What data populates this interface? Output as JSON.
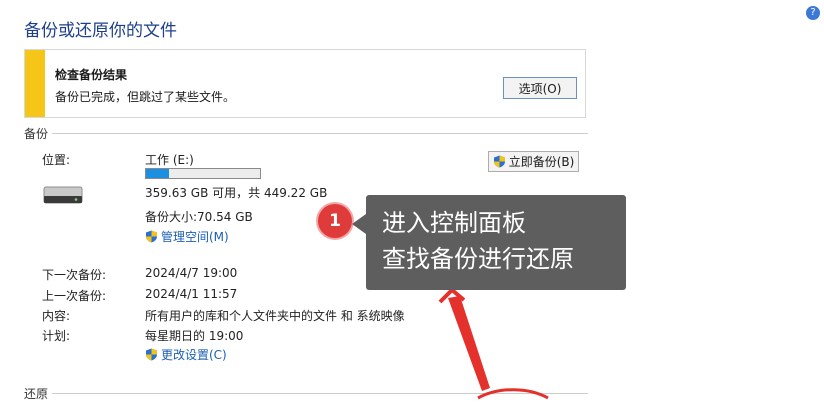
{
  "page": {
    "title": "备份或还原你的文件"
  },
  "warning": {
    "title": "检查备份结果",
    "message": "备份已完成，但跳过了某些文件。",
    "options_button": "选项(O)",
    "accent_color": "#f5c518"
  },
  "backup": {
    "section_label": "备份",
    "location_label": "位置:",
    "drive_name": "工作 (E:)",
    "drive_used_fraction": 0.2,
    "free_space_text": "359.63 GB 可用，共 449.22 GB",
    "backup_size_text": "备份大小:70.54 GB",
    "manage_space_link": "管理空间(M)",
    "backup_now_button": "立即备份(B)",
    "next_backup_label": "下一次备份:",
    "next_backup_value": "2024/4/7 19:00",
    "last_backup_label": "上一次备份:",
    "last_backup_value": "2024/4/1 11:57",
    "contents_label": "内容:",
    "contents_value": "所有用户的库和个人文件夹中的文件 和 系统映像",
    "schedule_label": "计划:",
    "schedule_value": "每星期日的 19:00",
    "change_settings_link": "更改设置(C)"
  },
  "restore": {
    "section_label": "还原"
  },
  "callout": {
    "step": "1",
    "line1": "进入控制面板",
    "line2": "查找备份进行还原",
    "badge_color": "#e03b3b"
  },
  "icons": [
    "question-icon",
    "drive-icon",
    "shield-icon",
    "arrow-icon"
  ]
}
